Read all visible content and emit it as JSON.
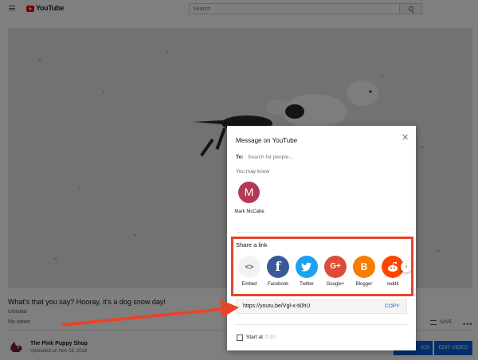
{
  "header": {
    "logo_text": "YouTube",
    "search_placeholder": "Search",
    "menu_icon": "hamburger-icon",
    "search_icon": "search-icon"
  },
  "video": {
    "title": "What's that you say? Hooray, it's a dog snow day!",
    "visibility": "Unlisted",
    "views": "No views",
    "save_label": "SAVE",
    "more_label": "•••"
  },
  "channel": {
    "name": "The Pink Puppy Shop",
    "uploaded": "Uploaded on Nov 28, 2018",
    "analytics_label": "ICS",
    "edit_label": "EDIT VIDEO"
  },
  "dialog": {
    "title": "Message on YouTube",
    "to_label": "To:",
    "to_placeholder": "Search for people...",
    "may_know_label": "You may know",
    "contacts": [
      {
        "initial": "M",
        "name": "Mark McCabe",
        "color": "#b13a56"
      }
    ],
    "share_link_label": "Share a link",
    "share_targets": [
      {
        "label": "Embed",
        "glyph": "<>",
        "color": "#f2f2f2",
        "icon": "embed-icon"
      },
      {
        "label": "Facebook",
        "glyph": "f",
        "color": "#3b5998",
        "icon": "facebook-icon"
      },
      {
        "label": "Twitter",
        "glyph": "🐦",
        "color": "#1da1f2",
        "icon": "twitter-icon"
      },
      {
        "label": "Google+",
        "glyph": "G+",
        "color": "#dd4b39",
        "icon": "google-plus-icon"
      },
      {
        "label": "Blogger",
        "glyph": "B",
        "color": "#f57d00",
        "icon": "blogger-icon"
      },
      {
        "label": "reddit",
        "glyph": "👽",
        "color": "#ff4500",
        "icon": "reddit-icon"
      }
    ],
    "url": "https://youtu.be/Vgl-x-ti0hU",
    "copy_label": "COPY",
    "start_at_label": "Start at",
    "start_at_time": "0:10"
  },
  "colors": {
    "accent_blue": "#065fd4",
    "annotation_red": "#e8442a",
    "youtube_red": "#e00000"
  }
}
